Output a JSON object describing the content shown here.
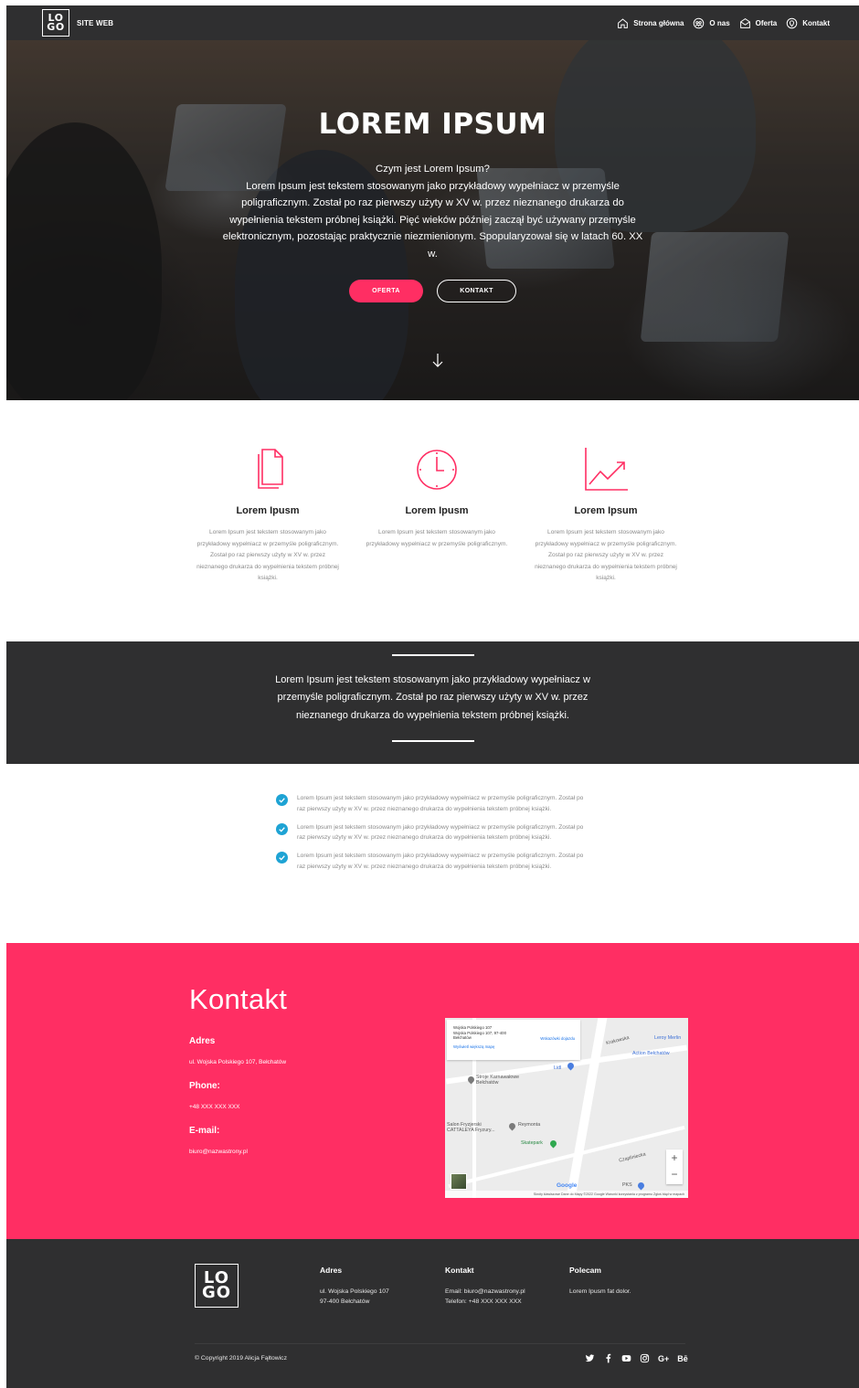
{
  "nav": {
    "logo_top": "LO",
    "logo_bottom": "GO",
    "site_name": "SITE WEB",
    "items": [
      {
        "label": "Strona główna",
        "icon": "home-icon"
      },
      {
        "label": "O nas",
        "icon": "group-icon"
      },
      {
        "label": "Oferta",
        "icon": "envelope-open-icon"
      },
      {
        "label": "Kontakt",
        "icon": "location-pin-icon"
      }
    ]
  },
  "hero": {
    "title": "LOREM IPSUM",
    "subtitle": "Czym jest Lorem Ipsum?",
    "text": "Lorem Ipsum jest tekstem stosowanym jako przykładowy wypełniacz w przemyśle poligraficznym. Został po raz pierwszy użyty w XV w. przez nieznanego drukarza do wypełnienia tekstem próbnej książki. Pięć wieków później zaczął być używany przemyśle elektronicznym, pozostając praktycznie niezmienionym. Spopularyzował się w latach 60. XX w.",
    "btn_primary": "OFERTA",
    "btn_secondary": "KONTAKT"
  },
  "features": [
    {
      "icon": "document-icon",
      "title": "Lorem Ipusm",
      "text": "Lorem Ipsum jest tekstem stosowanym jako przykładowy wypełniacz w przemyśle poligraficznym. Został po raz pierwszy użyty w XV w. przez nieznanego drukarza do wypełnienia tekstem próbnej książki."
    },
    {
      "icon": "clock-icon",
      "title": "Lorem Ipusm",
      "text": "Lorem Ipsum jest tekstem stosowanym jako przykładowy wypełniacz w przemyśle poligraficznym."
    },
    {
      "icon": "chart-trend-icon",
      "title": "Lorem Ipsum",
      "text": "Lorem Ipsum jest tekstem stosowanym jako przykładowy wypełniacz w przemyśle poligraficznym. Został po raz pierwszy użyty w XV w. przez nieznanego drukarza do wypełnienia tekstem próbnej książki."
    }
  ],
  "quote": {
    "text": "Lorem Ipsum jest tekstem stosowanym jako przykładowy wypełniacz w przemyśle poligraficznym. Został po raz pierwszy użyty w XV w. przez nieznanego drukarza do wypełnienia tekstem próbnej książki."
  },
  "checklist": [
    "Lorem Ipsum jest tekstem stosowanym jako przykładowy wypełniacz w przemyśle poligraficznym. Został po raz pierwszy użyty w XV w. przez nieznanego drukarza do wypełnienia tekstem próbnej książki.",
    "Lorem Ipsum jest tekstem stosowanym jako przykładowy wypełniacz w przemyśle poligraficznym. Został po raz pierwszy użyty w XV w. przez nieznanego drukarza do wypełnienia tekstem próbnej książki.",
    "Lorem Ipsum jest tekstem stosowanym jako przykładowy wypełniacz w przemyśle poligraficznym. Został po raz pierwszy użyty w XV w. przez nieznanego drukarza do wypełnienia tekstem próbnej książki."
  ],
  "contact": {
    "title": "Kontakt",
    "address_label": "Adres",
    "address_value": "ul. Wojska Polskiego 107, Bełchatów",
    "phone_label": "Phone:",
    "phone_value": "+48 XXX XXX XXX",
    "email_label": "E-mail:",
    "email_value": "biuro@nazwastrony.pl",
    "map": {
      "info_line1": "Wojska Polskiego 107",
      "info_line2": "Wojska Polskiego 107, 97-400",
      "info_line3": "Bełchatów",
      "directions": "Wskazówki dojazdu",
      "larger_map": "Wyświetl większą mapę",
      "labels": [
        "Leroy Merlin",
        "Action Bełchatów",
        "Lidl",
        "Stroje Karnawałowe Bełchatów",
        "Salon Fryzjerski CATTALEYA Fryzury...",
        "Reymonta",
        "Skatepark",
        "PKS",
        "Krakowska",
        "Czapliniecka"
      ],
      "google": "Google",
      "footer": "Skróty klawiszowe   Dane do Mapy ©2022 Google   Warunki korzystania z programu   Zgłoś błąd w mapach"
    }
  },
  "footer": {
    "logo_top": "LO",
    "logo_bottom": "GO",
    "col1_title": "Adres",
    "col1_line1": "ul. Wojska Polskiego 107",
    "col1_line2": "97-400 Bełchatów",
    "col2_title": "Kontakt",
    "col2_line1": "Email: biuro@nazwastrony.pl",
    "col2_line2": "Telefon: +48 XXX XXX XXX",
    "col3_title": "Polecam",
    "col3_line1": "Lorem Ipusm fat dolor.",
    "copyright": "© Copyright 2019 Alicja Fąłtowicz",
    "social_gplus": "G+",
    "social_behance": "Bē"
  },
  "colors": {
    "accent": "#ff2e63",
    "dark": "#2f2f30",
    "check": "#1ea3d4"
  }
}
